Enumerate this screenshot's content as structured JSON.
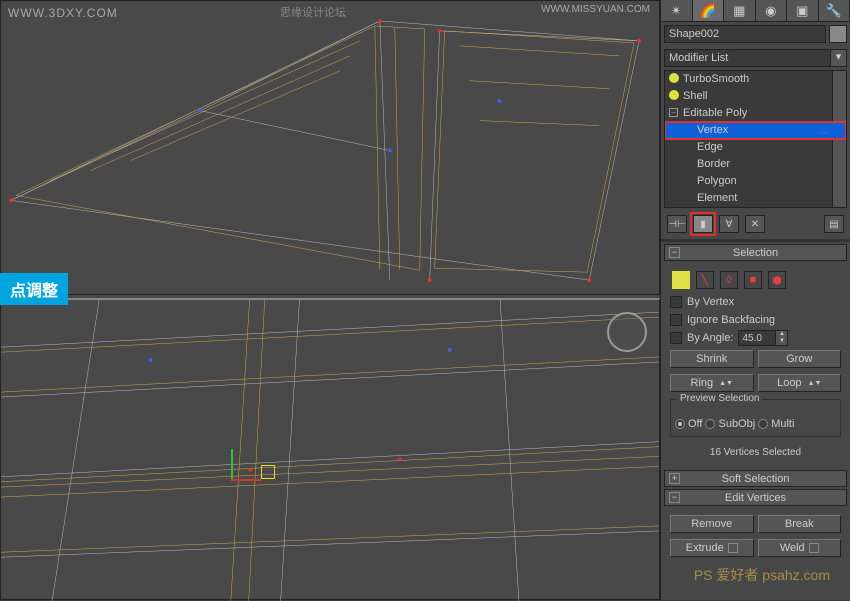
{
  "watermarks": {
    "top_left": "WWW.3DXY.COM",
    "center": "思缘设计论坛",
    "right": "WWW.MISSYUAN.COM",
    "bottom": "PS 爱好者 psahz.com"
  },
  "label_cyan": "点调整",
  "panel": {
    "object_name": "Shape002",
    "modifier_list": "Modifier List",
    "stack": [
      {
        "label": "TurboSmooth",
        "bulb": true
      },
      {
        "label": "Shell",
        "bulb": true
      },
      {
        "label": "Editable Poly",
        "expand": "−"
      },
      {
        "label": "Vertex",
        "lvl2": true,
        "sel": true
      },
      {
        "label": "Edge",
        "lvl2": true
      },
      {
        "label": "Border",
        "lvl2": true
      },
      {
        "label": "Polygon",
        "lvl2": true
      },
      {
        "label": "Element",
        "lvl2": true
      }
    ],
    "selection": {
      "title": "Selection",
      "by_vertex": "By Vertex",
      "ignore_backfacing": "Ignore Backfacing",
      "by_angle": "By Angle:",
      "angle_value": "45.0",
      "shrink": "Shrink",
      "grow": "Grow",
      "ring": "Ring",
      "loop": "Loop",
      "preview": "Preview Selection",
      "off": "Off",
      "subobj": "SubObj",
      "multi": "Multi",
      "status": "16 Vertices Selected"
    },
    "soft_selection": "Soft Selection",
    "edit_vertices": {
      "title": "Edit Vertices",
      "remove": "Remove",
      "break": "Break",
      "extrude": "Extrude",
      "weld": "Weld"
    }
  }
}
